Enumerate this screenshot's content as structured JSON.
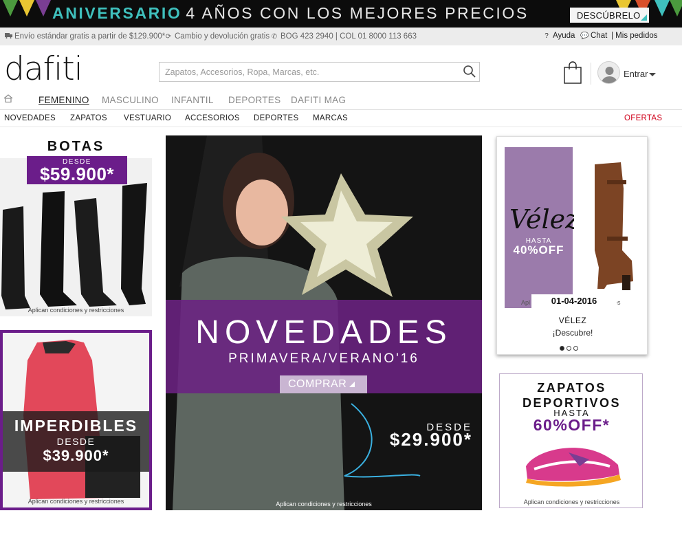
{
  "banner": {
    "title_accent": "ANIVERSARIO",
    "title_rest": "4 AÑOS CON LOS MEJORES PRECIOS",
    "cta_label": "DESCÚBRELO",
    "colors": {
      "background": "#0c0c0c",
      "accent": "#3fc0bd"
    }
  },
  "infobar": {
    "shipping": "Envío estándar gratis a partir de $129.900*",
    "returns": "Cambio y devolución gratis",
    "phone": "BOG 423 2940 | COL 01 8000 113 663",
    "help": "Ayuda",
    "chat": "Chat",
    "orders": "| Mis pedidos",
    "icons": [
      "truck-icon",
      "refresh-icon",
      "phone-icon",
      "help-icon",
      "chat-icon"
    ]
  },
  "header": {
    "logo": "dafiti",
    "search_placeholder": "Zapatos, Accesorios, Ropa, Marcas, etc.",
    "login_label": "Entrar"
  },
  "main_nav": {
    "items": [
      "FEMENINO",
      "MASCULINO",
      "INFANTIL",
      "DEPORTES",
      "DAFITI MAG"
    ],
    "active": "FEMENINO"
  },
  "sub_nav": {
    "items": [
      "NOVEDADES",
      "ZAPATOS",
      "VESTUARIO",
      "ACCESORIOS",
      "DEPORTES",
      "MARCAS"
    ],
    "offers": "OFERTAS",
    "offers_color": "#d0021b"
  },
  "promo_botas": {
    "title": "BOTAS",
    "desde": "DESDE",
    "price": "$59.900*",
    "conditions": "Aplican condiciones y restricciones",
    "accent": "#6b1d8a"
  },
  "promo_imperdibles": {
    "title": "IMPERDIBLES",
    "desde": "DESDE",
    "price": "$39.900*",
    "conditions": "Aplican condiciones y restricciones"
  },
  "hero": {
    "title": "NOVEDADES",
    "subtitle": "PRIMAVERA/VERANO'16",
    "cta": "COMPRAR",
    "desde": "DESDE",
    "price": "$29.900*",
    "conditions": "Aplican condiciones y restricciones"
  },
  "carousel": {
    "brand_mark": "Vélez",
    "hasta": "HASTA",
    "discount": "40%OFF",
    "date": "01-04-2016",
    "cond_left": "Apl",
    "cond_right": "es",
    "name": "VÉLEZ",
    "tagline": "¡Descubre!",
    "slides": 3,
    "active_slide": 1
  },
  "promo_zapatos": {
    "line1": "ZAPATOS",
    "line2": "DEPORTIVOS",
    "hasta": "HASTA",
    "discount": "60%OFF*",
    "conditions": "Aplican condiciones y restricciones"
  }
}
